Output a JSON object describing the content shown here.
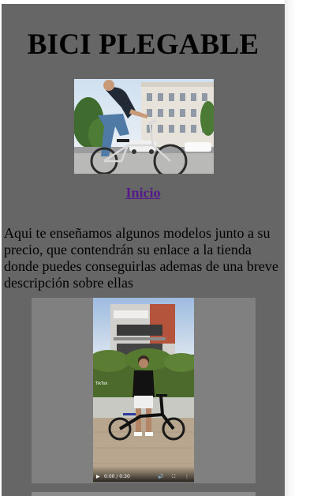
{
  "page": {
    "title": "BICI PLEGABLE",
    "home_link": "Inicio",
    "intro_text": "Aqui te enseñamos algunos modelos junto a su precio, que contendrán su enlace a la tienda donde puedes conseguirlas ademas de una breve descripción sobre ellas"
  },
  "video": {
    "time": "0:00 / 0:30",
    "watermark": "TikTok",
    "icons": [
      "play-icon",
      "volume-icon",
      "fullscreen-icon",
      "more-options-icon"
    ]
  },
  "colors": {
    "page_background": "#666666",
    "video_panel": "#808080",
    "link": "#551a8b",
    "text": "#000000"
  }
}
